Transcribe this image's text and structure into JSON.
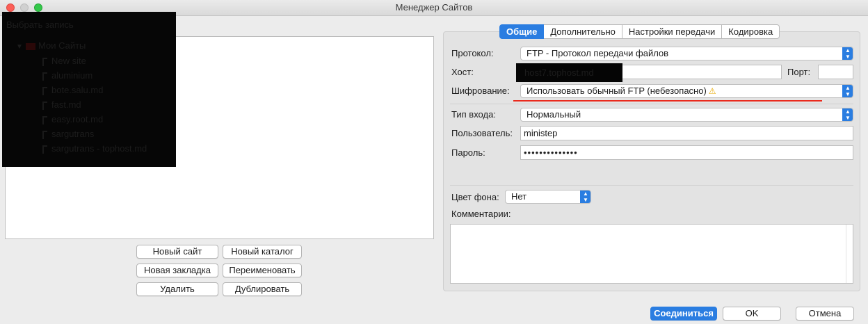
{
  "window": {
    "title": "Менеджер Сайтов"
  },
  "tree": {
    "header": "Выбрать запись",
    "root": "Мои Сайты",
    "sites": [
      "New site",
      "aluminium",
      "bote.salu.md",
      "fast.md",
      "easy.root.md",
      "sargutrans",
      "sargutrans - tophost.md"
    ]
  },
  "left_buttons": {
    "new_site": "Новый сайт",
    "new_folder": "Новый каталог",
    "new_bookmark": "Новая закладка",
    "rename": "Переименовать",
    "delete": "Удалить",
    "duplicate": "Дублировать"
  },
  "tabs": [
    "Общие",
    "Дополнительно",
    "Настройки передачи",
    "Кодировка"
  ],
  "form": {
    "protocol_label": "Протокол:",
    "protocol_value": "FTP - Протокол передачи файлов",
    "host_label": "Хост:",
    "host_value": "host7.tophost.md",
    "port_label": "Порт:",
    "port_value": "",
    "encryption_label": "Шифрование:",
    "encryption_value": "Использовать обычный FTP (небезопасно)",
    "logon_label": "Тип входа:",
    "logon_value": "Нормальный",
    "user_label": "Пользователь:",
    "user_value": "ministep",
    "password_label": "Пароль:",
    "password_value": "••••••••••••••",
    "bgcolor_label": "Цвет фона:",
    "bgcolor_value": "Нет",
    "comments_label": "Комментарии:"
  },
  "bottom_buttons": {
    "connect": "Соединиться",
    "ok": "OK",
    "cancel": "Отмена"
  },
  "colors": {
    "accent": "#2a7de1",
    "warning_underline": "#ea2a1d"
  }
}
